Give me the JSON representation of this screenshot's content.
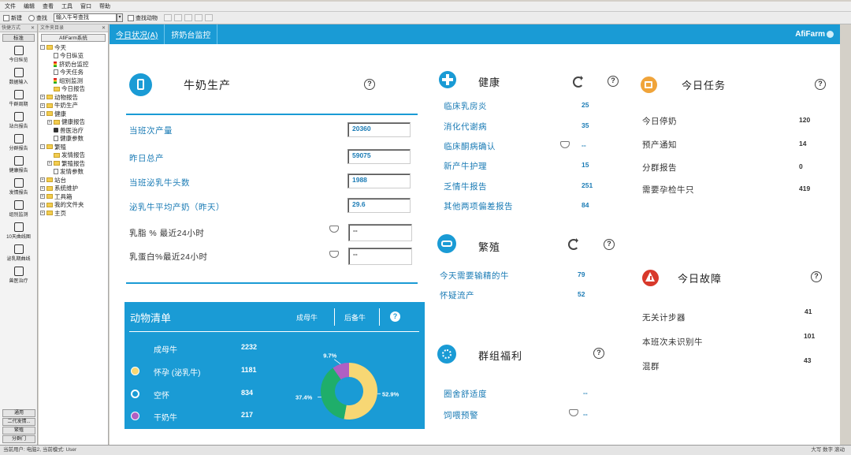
{
  "menu": [
    "文件",
    "编辑",
    "查看",
    "工具",
    "窗口",
    "帮助"
  ],
  "toolbar": {
    "new_label": "新建",
    "find_label": "查找",
    "search_placeholder": "输入牛号查找",
    "find_animal_label": "查找动物"
  },
  "left_panel": {
    "header": "快捷方式",
    "std_label": "标准",
    "items": [
      {
        "label": "今日纵览",
        "icon": "report-icon"
      },
      {
        "label": "数据输入",
        "icon": "import-icon"
      },
      {
        "label": "牛群周期",
        "icon": "cow-cycle-icon"
      },
      {
        "label": "站台报告",
        "icon": "stall-icon"
      },
      {
        "label": "分群报告",
        "icon": "group-icon"
      },
      {
        "label": "健康报告",
        "icon": "health-icon"
      },
      {
        "label": "发情报告",
        "icon": "heat-icon"
      },
      {
        "label": "组别监测",
        "icon": "monitor-icon"
      },
      {
        "label": "10天曲线图",
        "icon": "chart-icon"
      },
      {
        "label": "泌乳期曲线",
        "icon": "curve-icon"
      },
      {
        "label": "兽医治疗",
        "icon": "vet-icon"
      }
    ],
    "bottom": [
      "通用",
      "二代发情...",
      "繁殖",
      "分群门"
    ]
  },
  "tree": {
    "header": "文件夹目录",
    "title": "AfiFarm系统",
    "nodes": [
      {
        "label": "今天",
        "level": 0,
        "type": "folder",
        "exp": "-"
      },
      {
        "label": "今日纵览",
        "level": 1,
        "type": "page"
      },
      {
        "label": "挤奶台监控",
        "level": 1,
        "type": "light"
      },
      {
        "label": "今天任务",
        "level": 1,
        "type": "page"
      },
      {
        "label": "组别监测",
        "level": 1,
        "type": "light"
      },
      {
        "label": "今日报告",
        "level": 1,
        "type": "folder"
      },
      {
        "label": "动物报告",
        "level": 0,
        "type": "folder",
        "exp": "+"
      },
      {
        "label": "牛奶生产",
        "level": 0,
        "type": "folder",
        "exp": "+"
      },
      {
        "label": "健康",
        "level": 0,
        "type": "folder",
        "exp": "-"
      },
      {
        "label": "健康报告",
        "level": 1,
        "type": "folder",
        "exp": "+"
      },
      {
        "label": "兽医治疗",
        "level": 1,
        "type": "lock"
      },
      {
        "label": "健康参数",
        "level": 1,
        "type": "page"
      },
      {
        "label": "繁殖",
        "level": 0,
        "type": "folder",
        "exp": "-"
      },
      {
        "label": "发情报告",
        "level": 1,
        "type": "folder"
      },
      {
        "label": "繁殖报告",
        "level": 1,
        "type": "folder",
        "exp": "+"
      },
      {
        "label": "发情参数",
        "level": 1,
        "type": "page"
      },
      {
        "label": "站台",
        "level": 0,
        "type": "folder",
        "exp": "+"
      },
      {
        "label": "系统维护",
        "level": 0,
        "type": "folder",
        "exp": "+"
      },
      {
        "label": "工具箱",
        "level": 0,
        "type": "folder",
        "exp": "+"
      },
      {
        "label": "我的文件夹",
        "level": 0,
        "type": "folder",
        "exp": "+"
      },
      {
        "label": "主页",
        "level": 0,
        "type": "folder",
        "exp": "+"
      }
    ]
  },
  "tabs": [
    {
      "label": "今日状况(A)",
      "active": true
    },
    {
      "label": "挤奶台监控",
      "active": false
    }
  ],
  "brand": "AfiFarm",
  "milk": {
    "title": "牛奶生产",
    "rows": [
      {
        "label": "当班次产量",
        "value": "20360"
      },
      {
        "label": "昨日总产",
        "value": "59075"
      },
      {
        "label": "当班泌乳牛头数",
        "value": "1988"
      },
      {
        "label": "泌乳牛平均产奶（昨天）",
        "value": "29.6"
      },
      {
        "label": "乳脂 % 最近24小时",
        "value": "--"
      },
      {
        "label": "乳蛋白%最近24小时",
        "value": "--"
      }
    ]
  },
  "health": {
    "title": "健康",
    "rows": [
      {
        "label": "临床乳房炎",
        "value": "25"
      },
      {
        "label": "消化代谢病",
        "value": "35"
      },
      {
        "label": "临床酮病确认",
        "value": "--"
      },
      {
        "label": "新产牛护理",
        "value": "15"
      },
      {
        "label": "乏情牛报告",
        "value": "251"
      },
      {
        "label": "其他两项偏差报告",
        "value": "84"
      }
    ]
  },
  "breeding": {
    "title": "繁殖",
    "rows": [
      {
        "label": "今天需要输精的牛",
        "value": "79"
      },
      {
        "label": "怀疑流产",
        "value": "52"
      }
    ]
  },
  "welfare": {
    "title": "群组福利",
    "rows": [
      {
        "label": "圈舍舒适度",
        "value": "--"
      },
      {
        "label": "饲喂预警",
        "value": "--"
      }
    ]
  },
  "tasks": {
    "title": "今日任务",
    "rows": [
      {
        "label": "今日停奶",
        "value": "120"
      },
      {
        "label": "预产通知",
        "value": "14"
      },
      {
        "label": "分群报告",
        "value": "0"
      },
      {
        "label": "需要孕检牛只",
        "value": "419"
      }
    ]
  },
  "faults": {
    "title": "今日故障",
    "rows": [
      {
        "label": "无关计步器",
        "value": "41"
      },
      {
        "label": "本班次未识别牛",
        "value": "101"
      },
      {
        "label": "混群",
        "value": "43"
      }
    ]
  },
  "animals": {
    "title": "动物清单",
    "tab1": "成母牛",
    "tab2": "后备牛",
    "rows": [
      {
        "label": "成母牛",
        "value": "2232"
      },
      {
        "label": "怀孕 (泌乳牛)",
        "value": "1181"
      },
      {
        "label": "空怀",
        "value": "834"
      },
      {
        "label": "干奶牛",
        "value": "217"
      }
    ]
  },
  "chart_data": {
    "type": "pie",
    "categories": [
      "怀孕 (泌乳牛)",
      "空怀",
      "干奶牛"
    ],
    "values": [
      52.9,
      37.4,
      9.7
    ],
    "labels": [
      "52.9%",
      "37.4%",
      "9.7%"
    ],
    "colors": [
      "#f7d774",
      "#1fae6a",
      "#b05fc3"
    ],
    "donut": true
  },
  "status": {
    "left": "当前用户: 电脑2, 当前模式: User",
    "right": "大写  数字  滚动"
  },
  "colors": {
    "accent": "#1a9bd5",
    "label": "#1a7bb5"
  }
}
